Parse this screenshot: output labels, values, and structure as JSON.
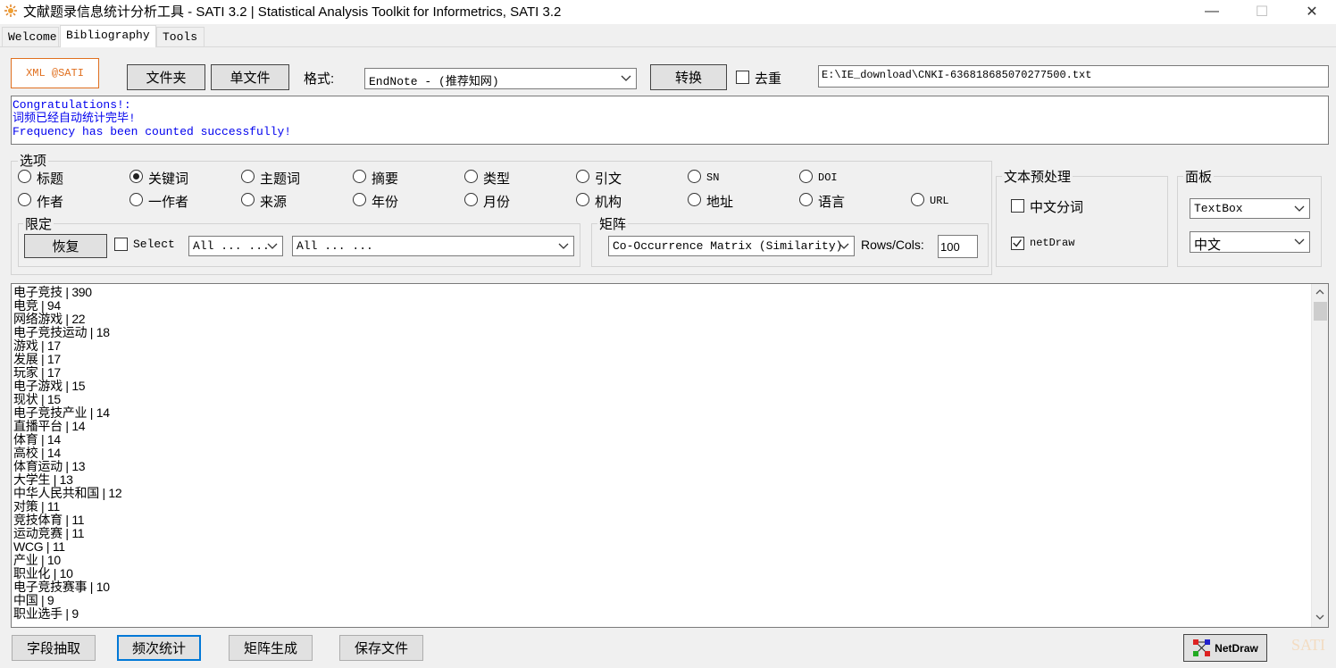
{
  "window": {
    "title": "文献题录信息统计分析工具 - SATI 3.2 | Statistical Analysis Toolkit for Informetrics, SATI 3.2",
    "minimize": "—",
    "maximize": "☐",
    "close": "✕"
  },
  "tabs": [
    {
      "label": "Welcome"
    },
    {
      "label": "Bibliography"
    },
    {
      "label": "Tools"
    }
  ],
  "toolbar": {
    "xml_label": "XML @SATI",
    "folder_label": "文件夹",
    "file_label": "单文件",
    "format_label": "格式:",
    "format_value": "EndNote  - (推荐知网)",
    "convert_label": "转换",
    "dedup_label": "去重",
    "dedup_checked": false,
    "path_value": "E:\\IE_download\\CNKI-636818685070277500.txt"
  },
  "log": [
    "Congratulations!:",
    "词频已经自动统计完毕!",
    "Frequency has been counted successfully!"
  ],
  "options": {
    "title": "选项",
    "fields": [
      {
        "label": "标题",
        "selected": false
      },
      {
        "label": "关键词",
        "selected": true
      },
      {
        "label": "主题词",
        "selected": false
      },
      {
        "label": "摘要",
        "selected": false
      },
      {
        "label": "类型",
        "selected": false
      },
      {
        "label": "引文",
        "selected": false
      },
      {
        "label": "SN",
        "selected": false
      },
      {
        "label": "DOI",
        "selected": false
      },
      {
        "label": "作者",
        "selected": false
      },
      {
        "label": "一作者",
        "selected": false
      },
      {
        "label": "来源",
        "selected": false
      },
      {
        "label": "年份",
        "selected": false
      },
      {
        "label": "月份",
        "selected": false
      },
      {
        "label": "机构",
        "selected": false
      },
      {
        "label": "地址",
        "selected": false
      },
      {
        "label": "语言",
        "selected": false
      },
      {
        "label": "URL",
        "selected": false
      }
    ]
  },
  "limit": {
    "title": "限定",
    "restore_label": "恢复",
    "select_label": "Select",
    "select_checked": false,
    "filter1": "All ... ...",
    "filter2": "All ... ..."
  },
  "matrix": {
    "title": "矩阵",
    "type_value": "Co-Occurrence Matrix (Similarity)",
    "rows_label": "Rows/Cols:",
    "rows_value": "100"
  },
  "text_preprocess": {
    "title": "文本预处理",
    "segmentation_label": "中文分词",
    "segmentation_checked": false,
    "netdraw_label": "netDraw",
    "netdraw_checked": true
  },
  "panel": {
    "title": "面板",
    "view_value": "TextBox",
    "language_value": "中文"
  },
  "results": [
    "电子竞技 | 390",
    "电竞 | 94",
    "网络游戏 | 22",
    "电子竞技运动 | 18",
    "游戏 | 17",
    "发展 | 17",
    "玩家 | 17",
    "电子游戏 | 15",
    "现状 | 15",
    "电子竞技产业 | 14",
    "直播平台 | 14",
    "体育 | 14",
    "高校 | 14",
    "体育运动 | 13",
    "大学生 | 13",
    "中华人民共和国 | 12",
    "对策 | 11",
    "竞技体育 | 11",
    "运动竞赛 | 11",
    "WCG | 11",
    "产业 | 10",
    "职业化 | 10",
    "电子竞技赛事 | 10",
    "中国 | 9",
    "职业选手 | 9"
  ],
  "actions": {
    "extract_label": "字段抽取",
    "frequency_label": "频次统计",
    "matrix_label": "矩阵生成",
    "save_label": "保存文件",
    "netdraw_label": "NetDraw",
    "logo_text": "SATI"
  }
}
